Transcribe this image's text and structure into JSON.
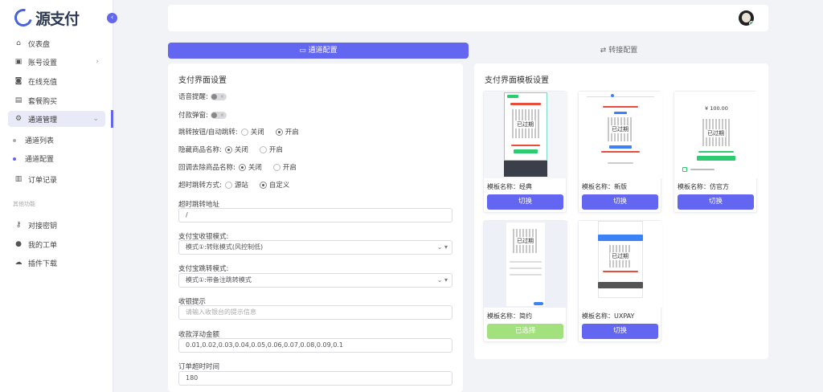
{
  "brand": {
    "logo_text": "源支付"
  },
  "sidebar": {
    "items": [
      {
        "label": "仪表盘",
        "icon": "home-icon"
      },
      {
        "label": "账号设置",
        "icon": "account-icon"
      },
      {
        "label": "在线充值",
        "icon": "recharge-icon"
      },
      {
        "label": "套餐购买",
        "icon": "package-icon"
      },
      {
        "label": "通道管理",
        "icon": "gear-icon"
      },
      {
        "label": "订单记录",
        "icon": "wallet-icon"
      }
    ],
    "sub_items": [
      "通道列表",
      "通道配置"
    ],
    "section_label": "其他功能",
    "other_items": [
      {
        "label": "对接密钥",
        "icon": "key-icon"
      },
      {
        "label": "我的工单",
        "icon": "chat-icon"
      },
      {
        "label": "插件下载",
        "icon": "cloud-download-icon"
      }
    ]
  },
  "tabs": {
    "active": "通道配置",
    "inactive": "转接配置"
  },
  "left_card": {
    "title": "支付界面设置",
    "voice_label": "语音提醒:",
    "popup_label": "付款弹窗:",
    "jump_button_label": "跳转按钮/自动跳转:",
    "hide_name_label": "隐藏商品名称:",
    "callback_label": "回调去除商品名称:",
    "timeout_jump_label": "超时跳转方式:",
    "off": "关闭",
    "on": "开启",
    "source_site": "源站",
    "custom": "自定义",
    "timeout_url_label": "超时跳转地址",
    "timeout_url_value": "/",
    "alipay_mode_label": "支付宝收银模式:",
    "alipay_mode_value": "模式①:转账模式(风控制低)",
    "alipay_jump_label": "支付宝跳转模式:",
    "alipay_jump_value": "模式①:带备注跳转模式",
    "tip_label": "收银提示",
    "tip_placeholder": "请输入收银台的提示信息",
    "float_label": "收款浮动金额",
    "float_value": "0.01,0.02,0.03,0.04,0.05,0.06,0.07,0.08,0.09,0.1",
    "order_timeout_label": "订单超时时间",
    "order_timeout_value": "180"
  },
  "right_card": {
    "title": "支付界面模板设置",
    "templates": [
      {
        "name": "模板名称：经典",
        "button": "切换"
      },
      {
        "name": "模板名称：新版",
        "button": "切换"
      },
      {
        "name": "模板名称：仿官方",
        "button": "切换",
        "amount": "¥ 100.00"
      },
      {
        "name": "模板名称：简约",
        "button": "已选择"
      },
      {
        "name": "模板名称：UXPAY",
        "button": "切换"
      }
    ],
    "qr_stamp": "已过期"
  },
  "colors": {
    "accent": "#6366f1",
    "selected": "#a3e07e"
  }
}
